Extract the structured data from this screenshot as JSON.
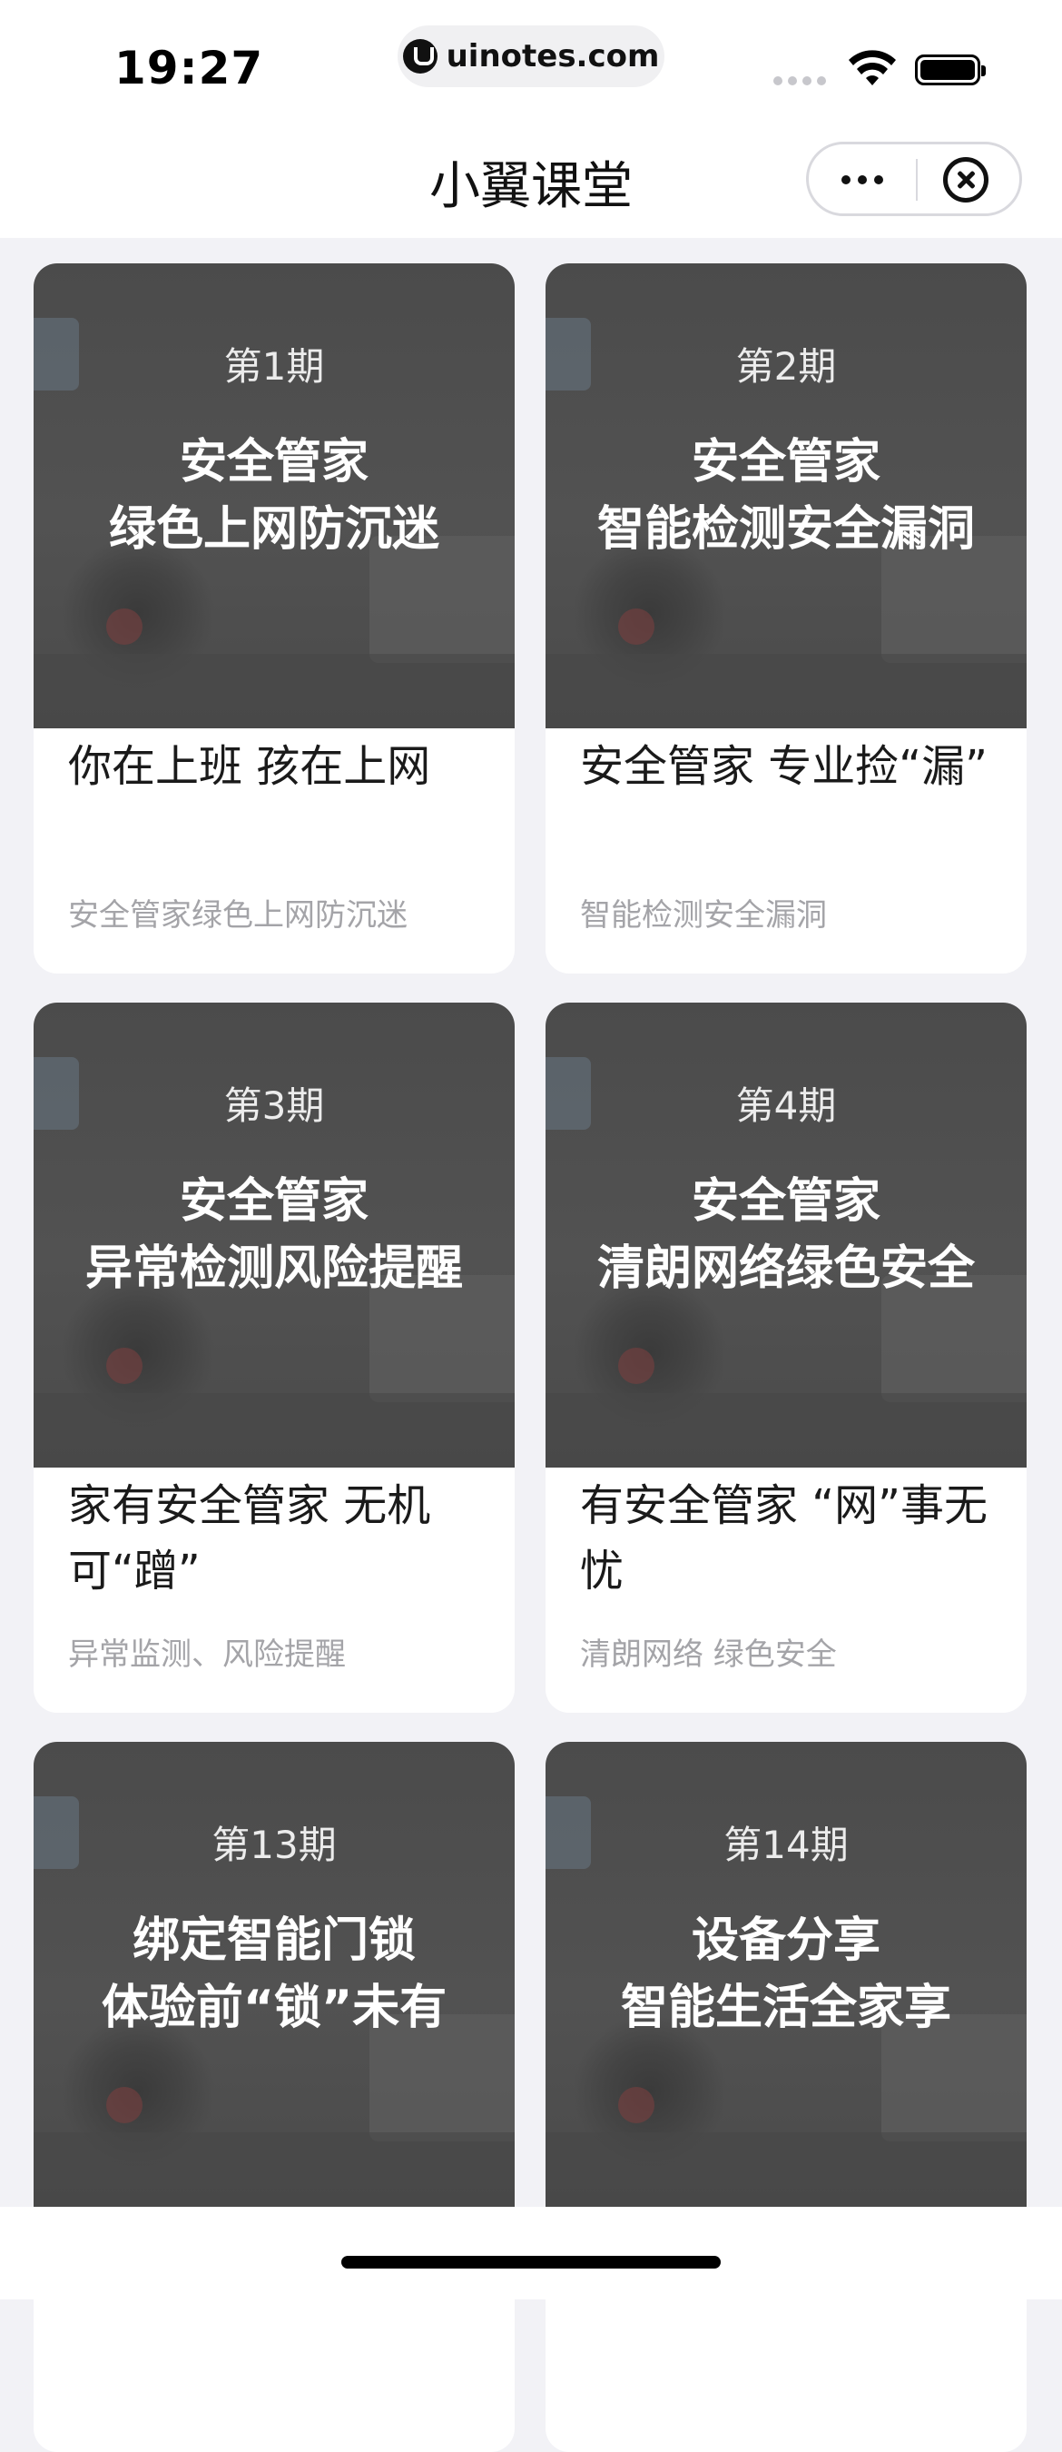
{
  "status_bar": {
    "time": "19:27",
    "url": "uinotes.com"
  },
  "navbar": {
    "title": "小翼课堂",
    "more_icon": "ellipsis-icon",
    "close_icon": "close-circle-icon"
  },
  "cards": [
    {
      "issue": "第1期",
      "headline_line1": "安全管家",
      "headline_line2": "绿色上网防沉迷",
      "title": "你在上班 孩在上网",
      "subtitle": "安全管家绿色上网防沉迷"
    },
    {
      "issue": "第2期",
      "headline_line1": "安全管家",
      "headline_line2": "智能检测安全漏洞",
      "title": "安全管家 专业捡“漏”",
      "subtitle": "智能检测安全漏洞"
    },
    {
      "issue": "第3期",
      "headline_line1": "安全管家",
      "headline_line2": "异常检测风险提醒",
      "title": "家有安全管家 无机可“蹭”",
      "subtitle": "异常监测、风险提醒"
    },
    {
      "issue": "第4期",
      "headline_line1": "安全管家",
      "headline_line2": "清朗网络绿色安全",
      "title": "有安全管家 “网”事无忧",
      "subtitle": "清朗网络 绿色安全"
    },
    {
      "issue": "第13期",
      "headline_line1": "绑定智能门锁",
      "headline_line2": "体验前“锁”未有",
      "title": "",
      "subtitle": ""
    },
    {
      "issue": "第14期",
      "headline_line1": "设备分享",
      "headline_line2": "智能生活全家享",
      "title": "",
      "subtitle": ""
    }
  ],
  "colors": {
    "page_bg": "#f2f2f6",
    "banner_overlay": "#4f4f4f",
    "title_text": "#1a1a1a",
    "subtitle_text": "#a4a4a8"
  }
}
